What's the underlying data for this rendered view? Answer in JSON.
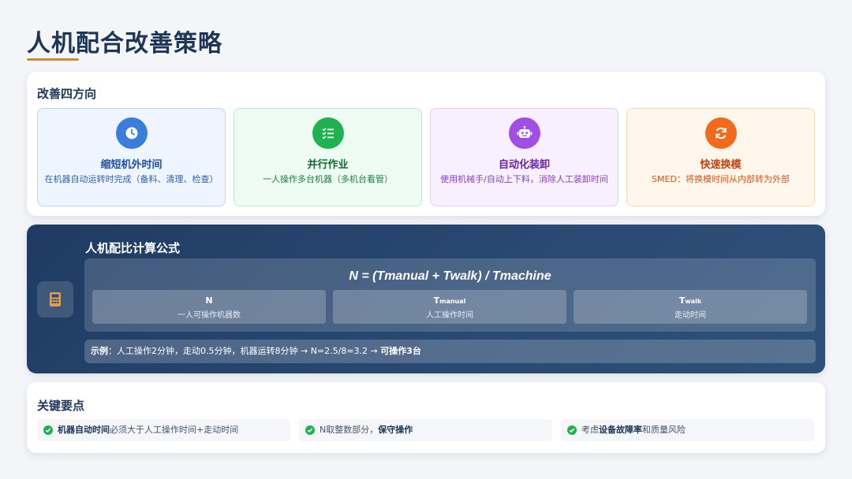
{
  "page": {
    "title": "人机配合改善策略"
  },
  "directions": {
    "heading": "改善四方向",
    "cards": [
      {
        "icon": "clock-icon",
        "title": "缩短机外时间",
        "desc": "在机器自动运转时完成（备料、清理、检查）"
      },
      {
        "icon": "list-check-icon",
        "title": "并行作业",
        "desc": "一人操作多台机器（多机台看管）"
      },
      {
        "icon": "robot-icon",
        "title": "自动化装卸",
        "desc": "使用机械手/自动上下料，消除人工装卸时间"
      },
      {
        "icon": "sync-icon",
        "title": "快速换模",
        "desc": "SMED：将换模时间从内部转为外部"
      }
    ]
  },
  "formula": {
    "heading": "人机配比计算公式",
    "icon": "calculator-icon",
    "expression": "N = (Tmanual + Twalk) / Tmachine",
    "variables": [
      {
        "symbol": "N",
        "sub": "",
        "meaning": "一人可操作机器数"
      },
      {
        "symbol": "T",
        "sub": "manual",
        "meaning": "人工操作时间"
      },
      {
        "symbol": "T",
        "sub": "walk",
        "meaning": "走动时间"
      }
    ],
    "example": {
      "label": "示例",
      "text": "：人工操作2分钟，走动0.5分钟，机器运转8分钟 → N=2.5/8≈3.2 → ",
      "result": "可操作3台"
    }
  },
  "keypoints": {
    "heading": "关键要点",
    "items": [
      {
        "bold": "机器自动时间",
        "rest": "必须大于人工操作时间+走动时间",
        "bold_first": true
      },
      {
        "pre": "N取整数部分，",
        "bold": "保守操作",
        "post": ""
      },
      {
        "pre": "考虑",
        "bold": "设备故障率",
        "post": "和质量风险"
      }
    ]
  },
  "colors": {
    "title": "#1d3557",
    "accent_underline": "#c98a3a",
    "blue": "#3b7ddd",
    "green": "#20b152",
    "purple": "#a14ee6",
    "orange": "#f26b1d",
    "formula_bg": "#1f3b63"
  }
}
